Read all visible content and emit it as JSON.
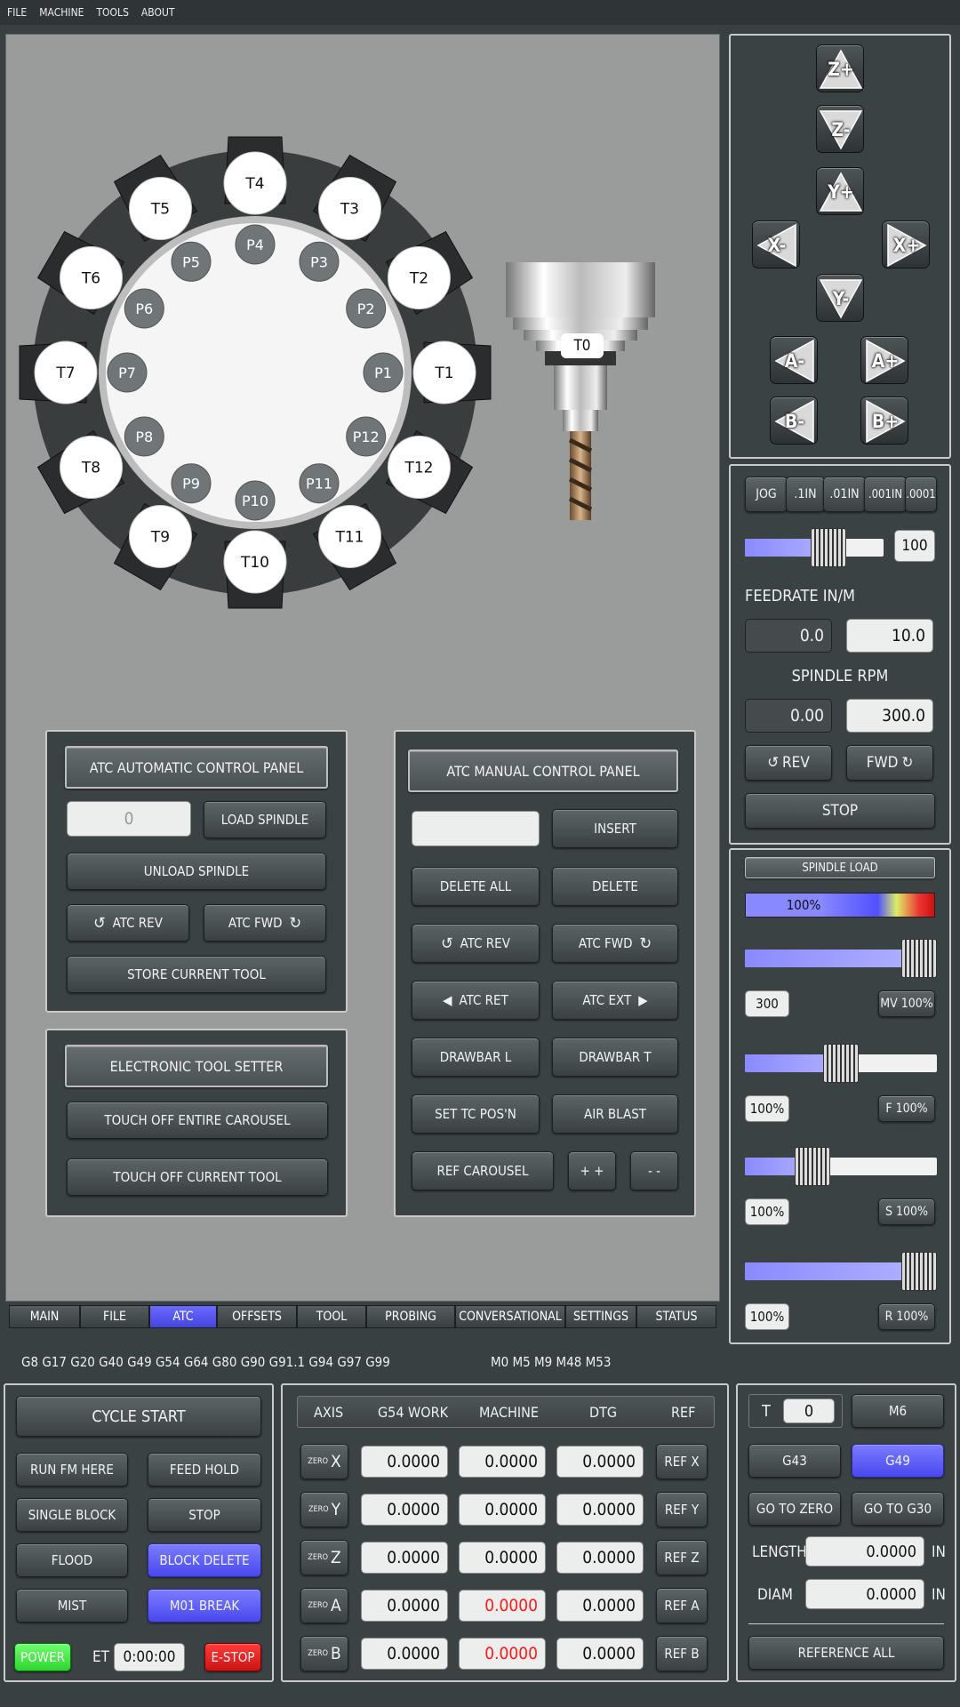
{
  "menu": [
    "FILE",
    "MACHINE",
    "TOOLS",
    "ABOUT"
  ],
  "carousel": {
    "outer": [
      "T1",
      "T2",
      "T3",
      "T4",
      "T5",
      "T6",
      "T7",
      "T8",
      "T9",
      "T10",
      "T11",
      "T12"
    ],
    "inner": [
      "P1",
      "P2",
      "P3",
      "P4",
      "P5",
      "P6",
      "P7",
      "P8",
      "P9",
      "P10",
      "P11",
      "P12"
    ],
    "spindle_tool": "T0"
  },
  "atc_auto": {
    "title": "ATC AUTOMATIC CONTROL PANEL",
    "tool_value": "0",
    "load": "LOAD SPINDLE",
    "unload": "UNLOAD SPINDLE",
    "rev": "ATC REV",
    "fwd": "ATC FWD",
    "store": "STORE CURRENT TOOL"
  },
  "ets": {
    "title": "ELECTRONIC TOOL SETTER",
    "touch_all": "TOUCH OFF ENTIRE CAROUSEL",
    "touch_current": "TOUCH OFF CURRENT TOOL"
  },
  "atc_manual": {
    "title": "ATC MANUAL CONTROL PANEL",
    "insert": "INSERT",
    "delete_all": "DELETE ALL",
    "delete": "DELETE",
    "rev": "ATC REV",
    "fwd": "ATC FWD",
    "ret": "ATC RET",
    "ext": "ATC EXT",
    "drawbar_l": "DRAWBAR L",
    "drawbar_t": "DRAWBAR T",
    "set_tc": "SET TC POS'N",
    "air_blast": "AIR BLAST",
    "ref_carousel": "REF CAROUSEL",
    "plus": "+ +",
    "minus": "- -"
  },
  "tabs": [
    "MAIN",
    "FILE",
    "ATC",
    "OFFSETS",
    "TOOL",
    "PROBING",
    "CONVERSATIONAL",
    "SETTINGS",
    "STATUS"
  ],
  "active_tab": "ATC",
  "jog": {
    "labels": [
      "Z+",
      "Z-",
      "Y+",
      "X-",
      "X+",
      "Y-",
      "A-",
      "A+",
      "B-",
      "B+"
    ]
  },
  "jog_modes": [
    "JOG",
    ".1IN",
    ".01IN",
    ".001IN",
    ".0001"
  ],
  "jog_rate": {
    "value": "100",
    "fraction": 0.6
  },
  "feed": {
    "label": "FEEDRATE IN/M",
    "current": "0.0",
    "set": "10.0"
  },
  "spindle": {
    "label": "SPINDLE RPM",
    "current": "0.00",
    "set": "300.0",
    "rev": "REV",
    "fwd": "FWD",
    "stop": "STOP"
  },
  "overrides": {
    "spindle_load_label": "SPINDLE LOAD",
    "load_pct": "100%",
    "load_fraction": 1.0,
    "mv": {
      "value": "300",
      "btn": "MV 100%",
      "fraction": 1.0
    },
    "f": {
      "value": "100%",
      "btn": "F 100%",
      "fraction": 0.5
    },
    "s": {
      "value": "100%",
      "btn": "S 100%",
      "fraction": 0.35
    },
    "r": {
      "value": "100%",
      "btn": "R 100%",
      "fraction": 1.0
    }
  },
  "gcodes": "G8 G17 G20 G40 G49 G54 G64 G80 G90 G91.1 G94 G97 G99",
  "mcodes": "M0 M5 M9 M48 M53",
  "control": {
    "cycle_start": "CYCLE START",
    "run_from": "RUN FM HERE",
    "feed_hold": "FEED HOLD",
    "single_block": "SINGLE BLOCK",
    "stop": "STOP",
    "flood": "FLOOD",
    "block_delete": "BLOCK DELETE",
    "mist": "MIST",
    "m01": "M01 BREAK",
    "power": "POWER",
    "et_label": "ET",
    "et_value": "0:00:00",
    "estop": "E-STOP"
  },
  "dro": {
    "headers": [
      "AXIS",
      "G54 WORK",
      "MACHINE",
      "DTG",
      "REF"
    ],
    "rows": [
      {
        "axis": "X",
        "work": "0.0000",
        "machine": "0.0000",
        "dtg": "0.0000",
        "ref": "REF X"
      },
      {
        "axis": "Y",
        "work": "0.0000",
        "machine": "0.0000",
        "dtg": "0.0000",
        "ref": "REF Y"
      },
      {
        "axis": "Z",
        "work": "0.0000",
        "machine": "0.0000",
        "dtg": "0.0000",
        "ref": "REF Z"
      },
      {
        "axis": "A",
        "work": "0.0000",
        "machine": "0.0000",
        "dtg": "0.0000",
        "ref": "REF A"
      },
      {
        "axis": "B",
        "work": "0.0000",
        "machine": "0.0000",
        "dtg": "0.0000",
        "ref": "REF B"
      }
    ],
    "zero": "ZERO"
  },
  "tool": {
    "t_label": "T",
    "t_value": "0",
    "m6": "M6",
    "g43": "G43",
    "g49": "G49",
    "go_zero": "GO TO ZERO",
    "go_g30": "GO TO G30",
    "length_label": "LENGTH",
    "length": "0.0000",
    "diam_label": "DIAM",
    "diam": "0.0000",
    "unit": "IN",
    "ref_all": "REFERENCE ALL"
  },
  "colors": {
    "accent": "#5050f0",
    "alarm": "#ff2020",
    "power": "#3ddd3d"
  }
}
